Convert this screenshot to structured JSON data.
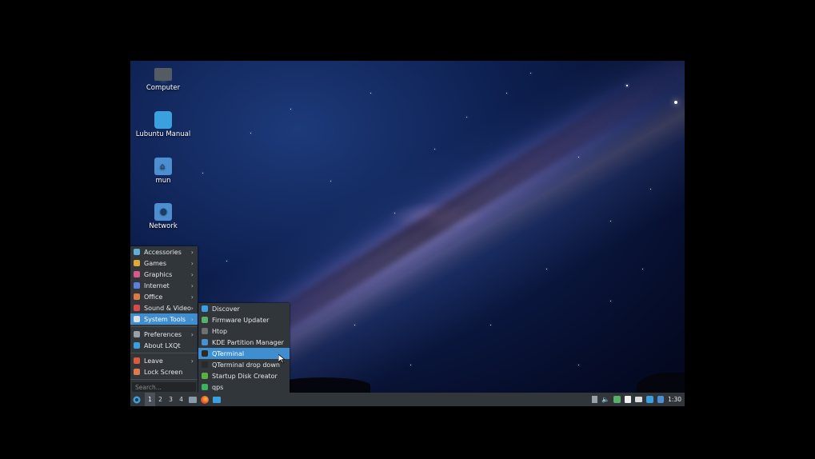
{
  "desktop": {
    "icons": [
      {
        "label": "Computer",
        "icon": "computer-icon",
        "color": "#555b63"
      },
      {
        "label": "Lubuntu Manual",
        "icon": "book-icon",
        "color": "#3aa0e0"
      },
      {
        "label": "mun",
        "icon": "home-folder-icon",
        "color": "#4c8ed0"
      },
      {
        "label": "Network",
        "icon": "network-folder-icon",
        "color": "#4c8ed0"
      }
    ]
  },
  "main_menu": {
    "items": [
      {
        "label": "Accessories",
        "icon": "accessories-icon",
        "color": "#5fb0d8",
        "submenu": true
      },
      {
        "label": "Games",
        "icon": "games-icon",
        "color": "#e0a830",
        "submenu": true
      },
      {
        "label": "Graphics",
        "icon": "graphics-icon",
        "color": "#d85a8a",
        "submenu": true
      },
      {
        "label": "Internet",
        "icon": "internet-icon",
        "color": "#5a80e0",
        "submenu": true
      },
      {
        "label": "Office",
        "icon": "office-icon",
        "color": "#e07840",
        "submenu": true
      },
      {
        "label": "Sound & Video",
        "icon": "sound-video-icon",
        "color": "#d84a4a",
        "submenu": true
      },
      {
        "label": "System Tools",
        "icon": "system-tools-icon",
        "color": "#e0e0e0",
        "submenu": true,
        "highlighted": true
      }
    ],
    "settings_items": [
      {
        "label": "Preferences",
        "icon": "preferences-icon",
        "color": "#9aa0a8",
        "submenu": true
      },
      {
        "label": "About LXQt",
        "icon": "lxqt-icon",
        "color": "#3aa0e0",
        "submenu": false
      }
    ],
    "session_items": [
      {
        "label": "Leave",
        "icon": "leave-icon",
        "color": "#e05a3a",
        "submenu": true
      },
      {
        "label": "Lock Screen",
        "icon": "lock-icon",
        "color": "#e07a4a",
        "submenu": false
      }
    ],
    "search_placeholder": "Search..."
  },
  "submenu": {
    "items": [
      {
        "label": "Discover",
        "icon": "discover-icon",
        "color": "#3aa0e0"
      },
      {
        "label": "Firmware Updater",
        "icon": "firmware-icon",
        "color": "#5ab06a"
      },
      {
        "label": "Htop",
        "icon": "htop-icon",
        "color": "#707070"
      },
      {
        "label": "KDE Partition Manager",
        "icon": "partition-icon",
        "color": "#4a90d0"
      },
      {
        "label": "QTerminal",
        "icon": "terminal-icon",
        "color": "#2a2a2a",
        "highlighted": true
      },
      {
        "label": "QTerminal drop down",
        "icon": "terminal-dropdown-icon",
        "color": "#2a2a2a"
      },
      {
        "label": "Startup Disk Creator",
        "icon": "usb-icon",
        "color": "#5ab040"
      },
      {
        "label": "qps",
        "icon": "qps-icon",
        "color": "#40b060"
      }
    ]
  },
  "panel": {
    "desktops": [
      "1",
      "2",
      "3",
      "4"
    ],
    "active_desktop": "1",
    "clock": "1:30"
  }
}
